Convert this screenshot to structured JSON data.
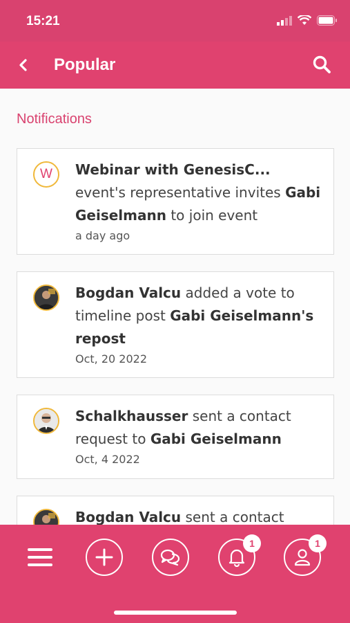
{
  "status_bar": {
    "time": "15:21"
  },
  "header": {
    "title": "Popular"
  },
  "section": {
    "title": "Notifications"
  },
  "notifications": [
    {
      "avatar_letter": "W",
      "parts": {
        "a": "Webinar with GenesisC...",
        "b": " event's representative invites ",
        "c": "Gabi Geiselmann",
        "d": " to join event"
      },
      "time": "a day ago"
    },
    {
      "parts": {
        "a": "Bogdan Valcu",
        "b": " added a vote to timeline post ",
        "c": "Gabi Geiselmann's repost",
        "d": ""
      },
      "time": "Oct, 20 2022"
    },
    {
      "parts": {
        "a": "Schalkhausser",
        "b": " sent a contact request to ",
        "c": "Gabi Geiselmann",
        "d": ""
      },
      "time": "Oct, 4 2022"
    },
    {
      "parts": {
        "a": "Bogdan Valcu",
        "b": " sent a contact",
        "c": "",
        "d": ""
      },
      "time": ""
    }
  ],
  "bottom_nav": {
    "notifications_badge": "1",
    "profile_badge": "1"
  },
  "colors": {
    "brand": "#e0426f",
    "accent_ring": "#f0b83a"
  }
}
